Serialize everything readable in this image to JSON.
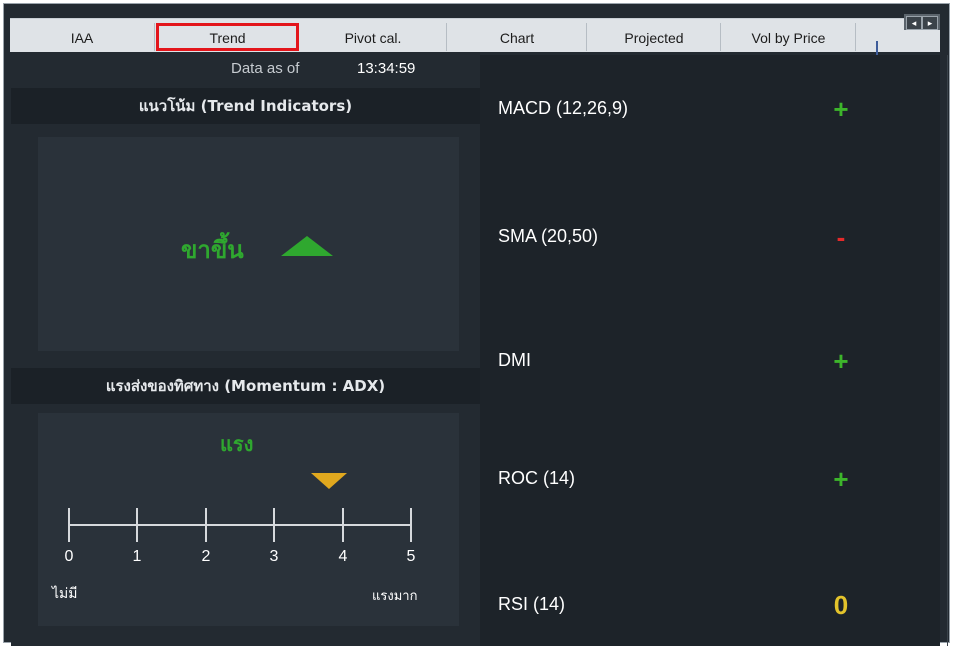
{
  "tabs": [
    {
      "label": "IAA",
      "selected": false
    },
    {
      "label": "Trend",
      "selected": true
    },
    {
      "label": "Pivot cal.",
      "selected": false
    },
    {
      "label": "Chart",
      "selected": false
    },
    {
      "label": "Projected",
      "selected": false
    },
    {
      "label": "Vol by Price",
      "selected": false
    }
  ],
  "scroll_nav": {
    "left_glyph": "◂",
    "right_glyph": "▸"
  },
  "data_as_of": {
    "label": "Data as of",
    "time": "13:34:59"
  },
  "trend": {
    "header": "แนวโน้ม (Trend Indicators)",
    "value": "ขาขึ้น",
    "arrow_icon": "up-triangle-icon",
    "color": "#2fa82f"
  },
  "momentum": {
    "header": "แรงส่งของทิศทาง (Momentum : ADX)",
    "value": "แรง",
    "marker_value": 3.8,
    "marker_color": "#e0a81e",
    "scale_ticks": [
      "0",
      "1",
      "2",
      "3",
      "4",
      "5"
    ],
    "scale_low_label": "ไม่มี",
    "scale_high_label": "แรงมาก"
  },
  "indicators": [
    {
      "name": "MACD (12,26,9)",
      "signal": "+",
      "color": "#3db52b"
    },
    {
      "name": "SMA (20,50)",
      "signal": "-",
      "color": "#e52a2a"
    },
    {
      "name": "DMI",
      "signal": "+",
      "color": "#3db52b"
    },
    {
      "name": "ROC (14)",
      "signal": "+",
      "color": "#3db52b"
    },
    {
      "name": "RSI (14)",
      "signal": "0",
      "color": "#e3c32b"
    }
  ]
}
